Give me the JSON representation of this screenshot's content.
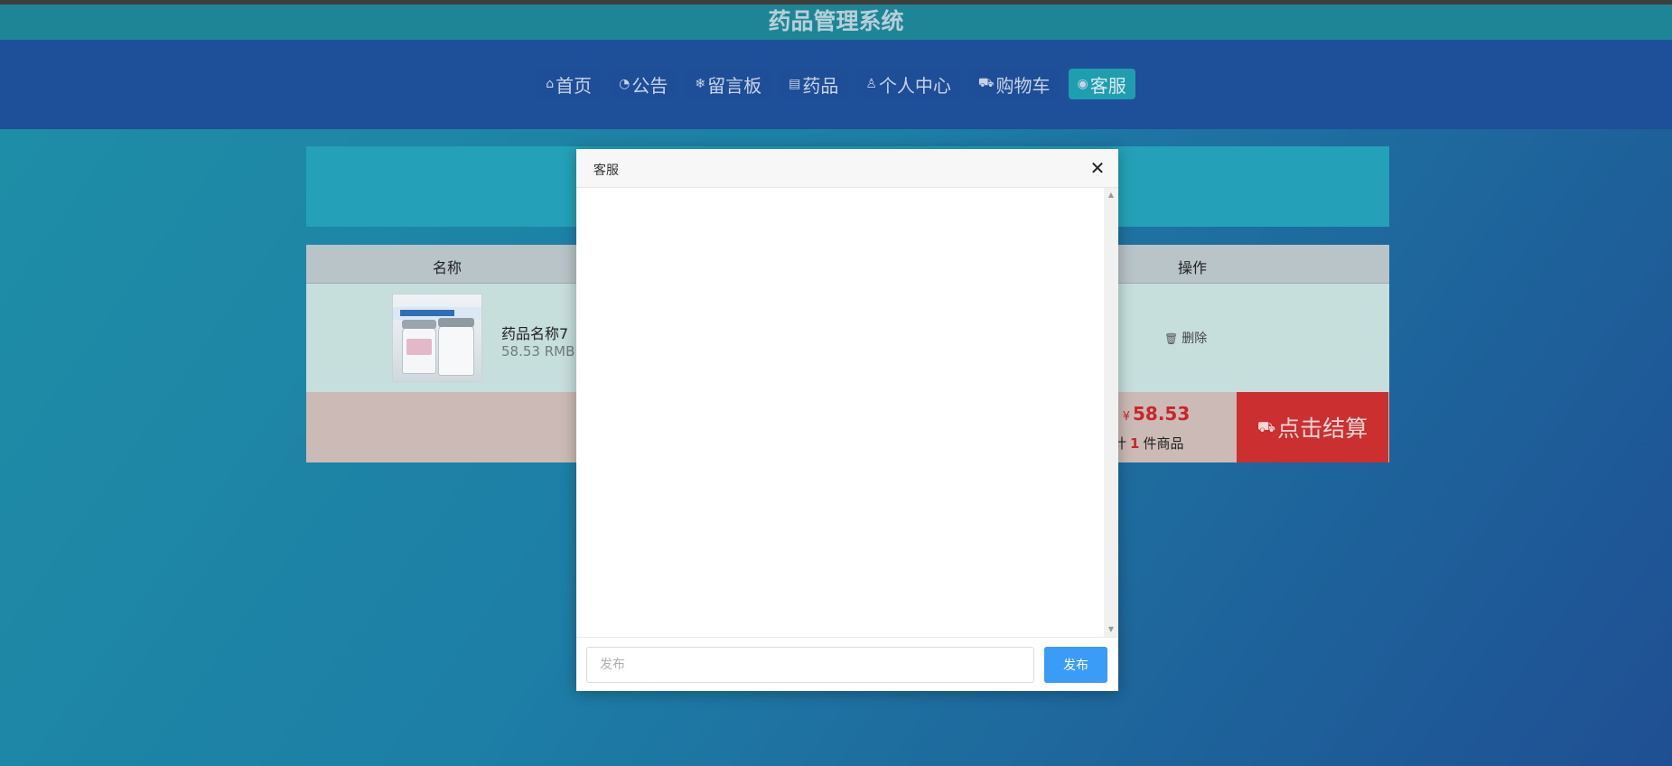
{
  "app": {
    "title": "药品管理系统"
  },
  "nav": {
    "items": [
      {
        "label": "首页",
        "icon": "home-icon",
        "glyph": "⌂"
      },
      {
        "label": "公告",
        "icon": "gauge-icon",
        "glyph": "◔"
      },
      {
        "label": "留言板",
        "icon": "snowflake-icon",
        "glyph": "❄"
      },
      {
        "label": "药品",
        "icon": "clipboard-icon",
        "glyph": "▤"
      },
      {
        "label": "个人中心",
        "icon": "user-icon",
        "glyph": "♙"
      },
      {
        "label": "购物车",
        "icon": "cart-icon",
        "glyph": "⛟"
      },
      {
        "label": "客服",
        "icon": "chat-icon",
        "glyph": "◉",
        "active": true
      }
    ]
  },
  "cart": {
    "columns": {
      "name": "名称",
      "operation": "操作"
    },
    "items": [
      {
        "name": "药品名称7",
        "price": "58.53 RMB",
        "delete_label": "删除"
      }
    ],
    "summary": {
      "total_prefix": ":",
      "currency": "¥",
      "total": "58.53",
      "count_prefix": "计",
      "count": "1",
      "count_suffix": "件商品"
    },
    "checkout_label": "点击结算"
  },
  "modal": {
    "title": "客服",
    "close_glyph": "✕",
    "input_placeholder": "发布",
    "input_value": "",
    "send_label": "发布"
  },
  "colors": {
    "header": "#1e8597",
    "nav": "#1e4f99",
    "accent": "#1f9eb0",
    "checkout": "#cb2f30",
    "send": "#3a9cf7"
  }
}
